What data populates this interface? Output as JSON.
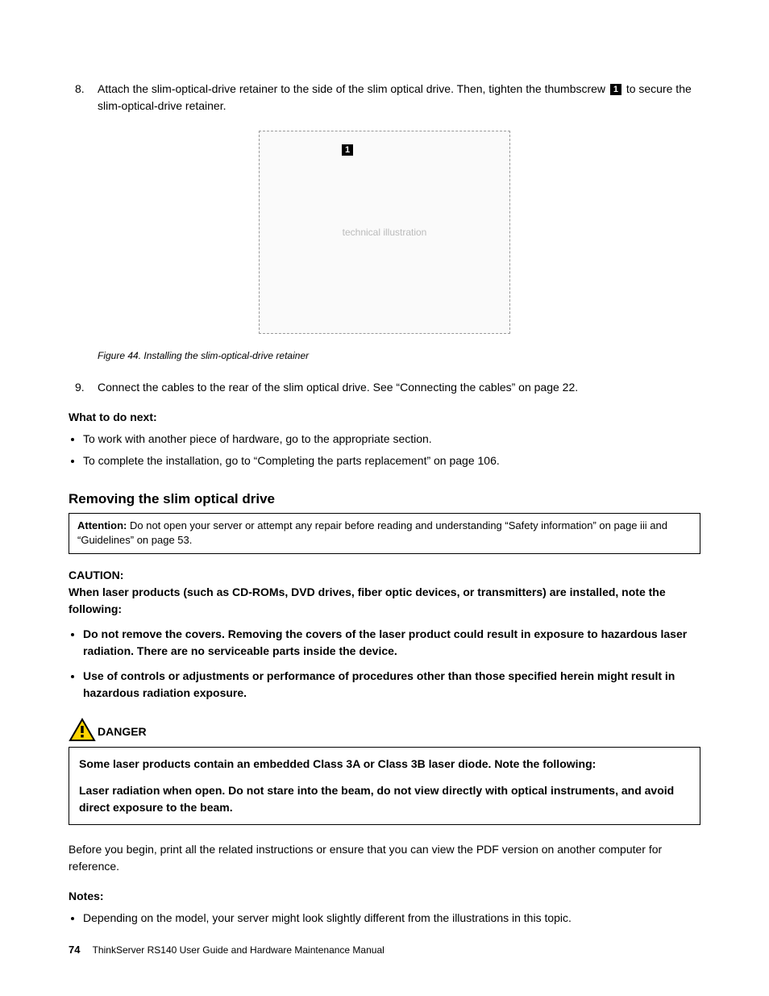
{
  "steps": {
    "s8": {
      "num": "8.",
      "text_a": "Attach the slim-optical-drive retainer to the side of the slim optical drive. Then, tighten the thumbscrew ",
      "callout": "1",
      "text_b": " to secure the slim-optical-drive retainer."
    },
    "s9": {
      "num": "9.",
      "text": "Connect the cables to the rear of the slim optical drive. See “Connecting the cables” on page 22."
    }
  },
  "figure": {
    "callout": "1",
    "placeholder": "technical illustration",
    "caption": "Figure 44.  Installing the slim-optical-drive retainer"
  },
  "what_next": {
    "heading": "What to do next:",
    "items": [
      "To work with another piece of hardware, go to the appropriate section.",
      "To complete the installation, go to “Completing the parts replacement” on page 106."
    ]
  },
  "section_title": "Removing the slim optical drive",
  "attention": {
    "label": "Attention:",
    "text": " Do not open your server or attempt any repair before reading and understanding “Safety information” on page iii and “Guidelines” on page 53."
  },
  "caution": {
    "label": "CAUTION:",
    "intro": "When laser products (such as CD-ROMs, DVD drives, fiber optic devices, or transmitters) are installed, note the following:",
    "items": [
      "Do not remove the covers. Removing the covers of the laser product could result in exposure to hazardous laser radiation. There are no serviceable parts inside the device.",
      "Use of controls or adjustments or performance of procedures other than those specified herein might result in hazardous radiation exposure."
    ]
  },
  "danger": {
    "label": "DANGER",
    "p1": "Some laser products contain an embedded Class 3A or Class 3B laser diode. Note the following:",
    "p2": "Laser radiation when open. Do not stare into the beam, do not view directly with optical instruments, and avoid direct exposure to the beam."
  },
  "before_begin": "Before you begin, print all the related instructions or ensure that you can view the PDF version on another computer for reference.",
  "notes": {
    "heading": "Notes:",
    "items": [
      "Depending on the model, your server might look slightly different from the illustrations in this topic."
    ]
  },
  "footer": {
    "page": "74",
    "title": "ThinkServer RS140 User Guide and Hardware Maintenance Manual"
  }
}
